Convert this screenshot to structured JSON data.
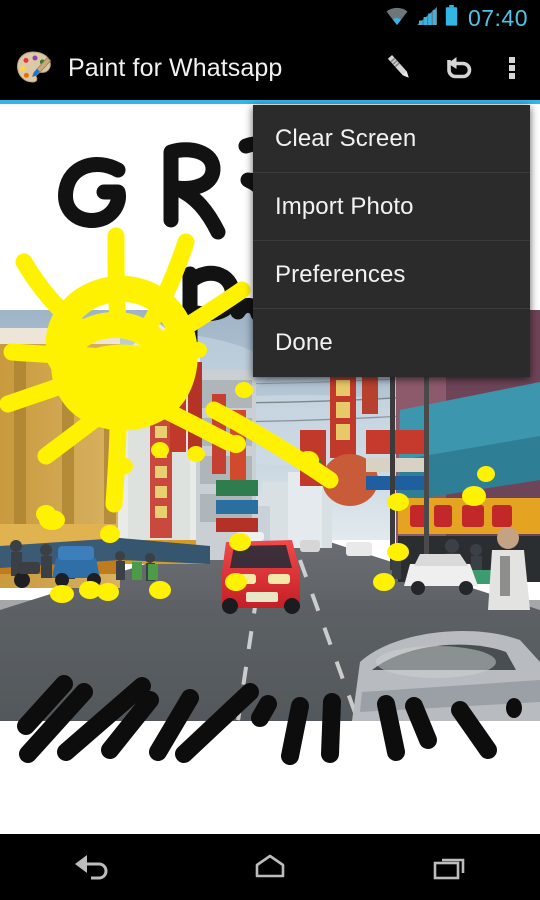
{
  "status_bar": {
    "time": "07:40",
    "time_color": "#4FC3E8",
    "icons": [
      "wifi-icon",
      "cell-signal-icon",
      "battery-icon"
    ]
  },
  "action_bar": {
    "app_icon": "paint-palette-icon",
    "title": "Paint for Whatsapp",
    "actions": [
      {
        "name": "pencil-icon",
        "label": "Pencil"
      },
      {
        "name": "undo-icon",
        "label": "Undo"
      },
      {
        "name": "overflow-menu-icon",
        "label": "More options"
      }
    ],
    "accent_color": "#33B5E5",
    "background_color": "#000000"
  },
  "overflow_menu": {
    "open": true,
    "background_color": "#2B2B2B",
    "items": [
      {
        "label": "Clear Screen"
      },
      {
        "label": "Import Photo"
      },
      {
        "label": "Preferences"
      },
      {
        "label": "Done"
      }
    ]
  },
  "canvas": {
    "background_color": "#FFFFFF",
    "brush_colors": {
      "black": "#111111",
      "yellow": "#FFF200"
    },
    "doodle_text": "GR",
    "photo_description": "Chinatown street scene with red taxi, Chinese signage and blue sky"
  },
  "nav_bar": {
    "background_color": "#000000",
    "buttons": [
      {
        "name": "back-nav-button",
        "label": "Back"
      },
      {
        "name": "home-nav-button",
        "label": "Home"
      },
      {
        "name": "recents-nav-button",
        "label": "Recent apps"
      }
    ]
  }
}
